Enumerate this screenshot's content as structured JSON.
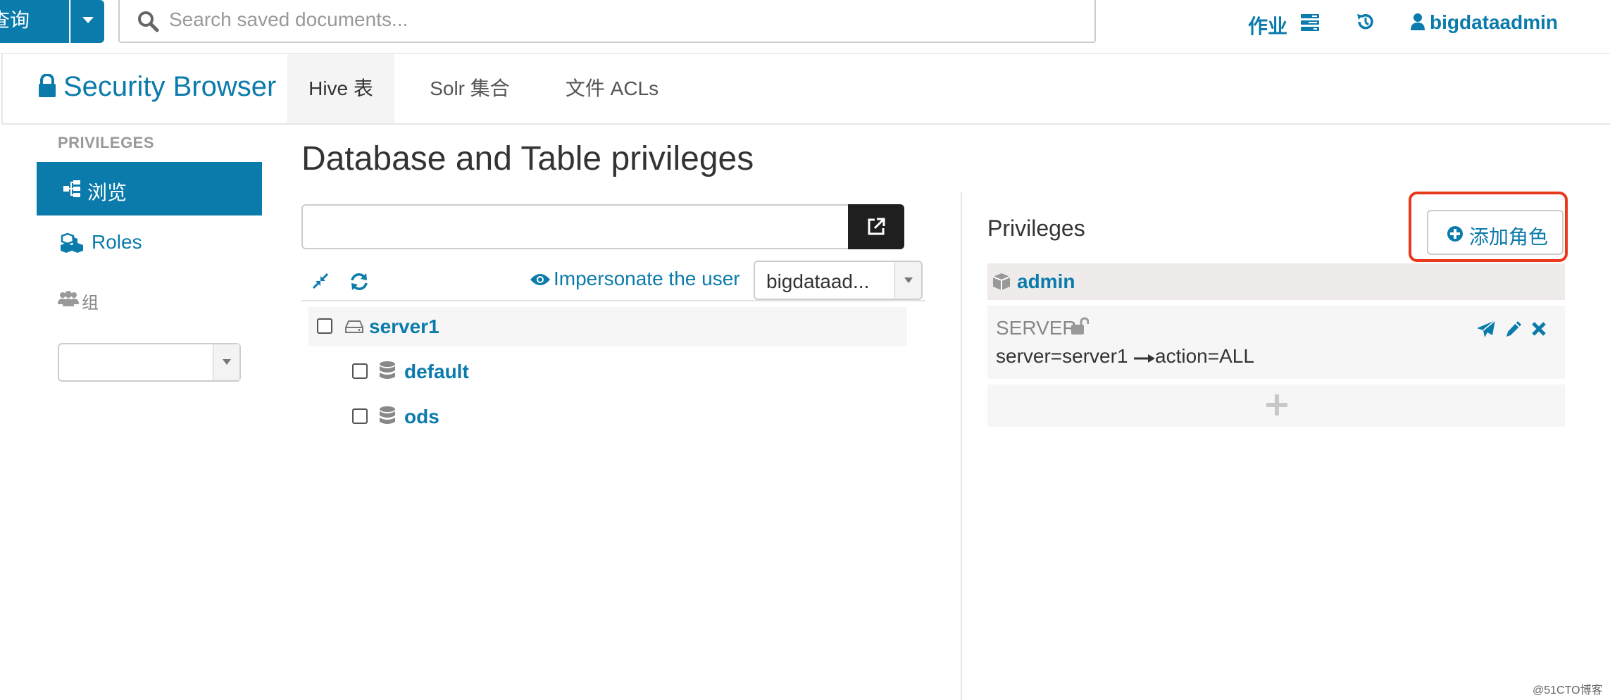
{
  "topbar": {
    "query_label": "查询",
    "search_placeholder": "Search saved documents...",
    "jobs_label": "作业",
    "user_label": "bigdataadmin"
  },
  "secondary": {
    "brand": "Security Browser",
    "tabs": [
      {
        "label": "Hive 表",
        "active": true
      },
      {
        "label": "Solr 集合",
        "active": false
      },
      {
        "label": "文件 ACLs",
        "active": false
      }
    ]
  },
  "sidebar": {
    "heading": "PRIVILEGES",
    "items": [
      {
        "label": "浏览",
        "icon": "sitemap-icon",
        "active": true
      },
      {
        "label": "Roles",
        "icon": "cubes-icon",
        "active": false
      },
      {
        "label": "组",
        "icon": "users-icon",
        "active": false
      }
    ],
    "group_select_value": ""
  },
  "main": {
    "title": "Database and Table privileges",
    "path_input_value": "",
    "impersonate_label": "Impersonate the user",
    "user_select_value": "bigdataad...",
    "tree": [
      {
        "label": "server1",
        "icon": "server-icon",
        "level": 0
      },
      {
        "label": "default",
        "icon": "database-icon",
        "level": 1
      },
      {
        "label": "ods",
        "icon": "database-icon",
        "level": 1
      }
    ]
  },
  "privileges": {
    "title": "Privileges",
    "add_role_label": "添加角色",
    "role": "admin",
    "card": {
      "scope": "SERVER",
      "detail_left": "server=server1",
      "detail_right": "action=ALL"
    }
  },
  "watermark": "@51CTO博客",
  "colors": {
    "accent": "#0b7bab",
    "highlight_frame": "#e8391d",
    "dark_button": "#1f1f1f"
  }
}
